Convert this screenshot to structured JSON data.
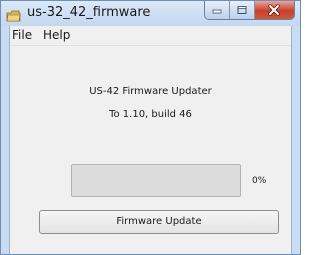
{
  "window": {
    "title": "us-32_42_firmware",
    "app_icon": "app-folder-icon",
    "controls": {
      "minimize_icon": "minimize-icon",
      "maximize_icon": "maximize-icon",
      "close_icon": "close-icon"
    }
  },
  "menu": {
    "items": [
      {
        "label": "File"
      },
      {
        "label": "Help"
      }
    ]
  },
  "main": {
    "heading": "US-42 Firmware Updater",
    "version_text": "To 1.10, build 46",
    "progress": {
      "value": 0,
      "label": "0%"
    },
    "update_button_label": "Firmware Update"
  },
  "colors": {
    "title_bar": "#c9dcf2",
    "content_background": "#f0f0f0",
    "progress_track": "#dcdcdc",
    "progress_fill": "#3cb043",
    "close_button": "#c7402b"
  }
}
